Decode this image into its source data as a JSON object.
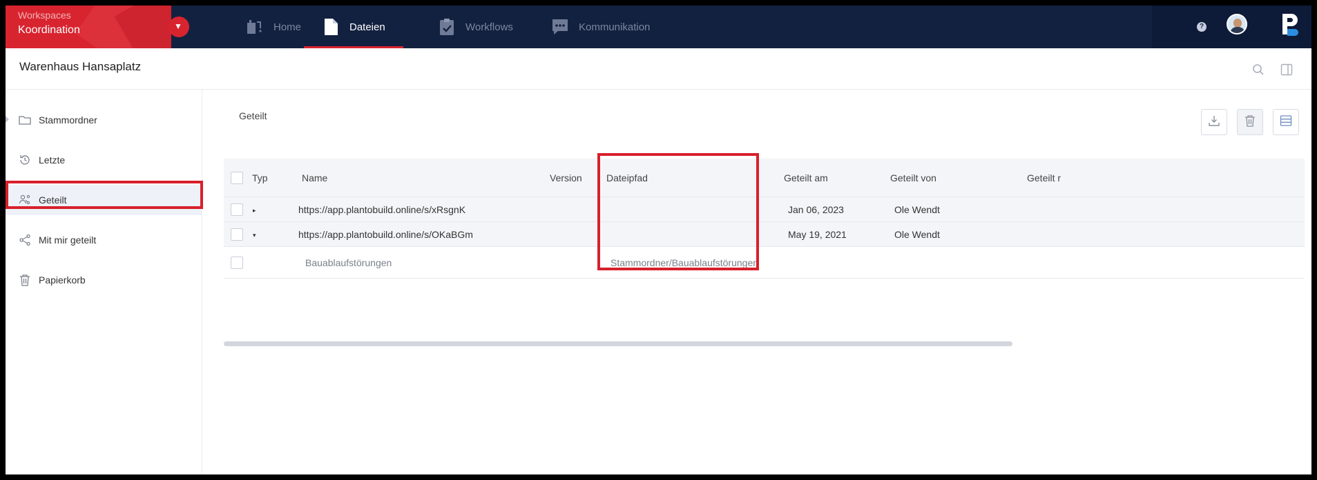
{
  "topbar": {
    "workspace_label": "Workspaces",
    "workspace_name": "Koordination",
    "nav": [
      {
        "label": "Home",
        "icon": "home-icon"
      },
      {
        "label": "Dateien",
        "icon": "file-icon",
        "active": true
      },
      {
        "label": "Workflows",
        "icon": "clipboard-check-icon"
      },
      {
        "label": "Kommunikation",
        "icon": "chat-icon"
      }
    ],
    "help_label": "?",
    "logo_letter": "P"
  },
  "header": {
    "title": "Warenhaus Hansaplatz"
  },
  "sidebar": {
    "items": [
      {
        "label": "Stammordner",
        "icon": "folder-icon"
      },
      {
        "label": "Letzte",
        "icon": "history-icon"
      },
      {
        "label": "Geteilt",
        "icon": "share-users-icon",
        "active": true
      },
      {
        "label": "Mit mir geteilt",
        "icon": "share-icon"
      },
      {
        "label": "Papierkorb",
        "icon": "trash-icon"
      }
    ]
  },
  "main": {
    "breadcrumb": "Geteilt",
    "toolbar": [
      "download-icon",
      "trash-icon",
      "list-view-icon"
    ]
  },
  "table": {
    "columns": [
      "Typ",
      "Name",
      "Version",
      "Dateipfad",
      "Geteilt am",
      "Geteilt von",
      "Geteilt r"
    ],
    "rows": [
      {
        "expander": "▸",
        "name": "https://app.plantobuild.online/s/xRsgnK",
        "version": "",
        "path": "",
        "date": "Jan 06, 2023",
        "by": "Ole Wendt"
      },
      {
        "expander": "▾",
        "name": "https://app.plantobuild.online/s/OKaBGm",
        "version": "",
        "path": "",
        "date": "May 19, 2021",
        "by": "Ole Wendt"
      },
      {
        "expander": "",
        "name": "Bauablaufstörungen",
        "version": "",
        "path": "Stammordner/Bauablaufstörungen",
        "date": "",
        "by": ""
      }
    ]
  },
  "colors": {
    "topbar": "#132140",
    "accent_red": "#d8242f",
    "highlight": "#d7202c"
  }
}
